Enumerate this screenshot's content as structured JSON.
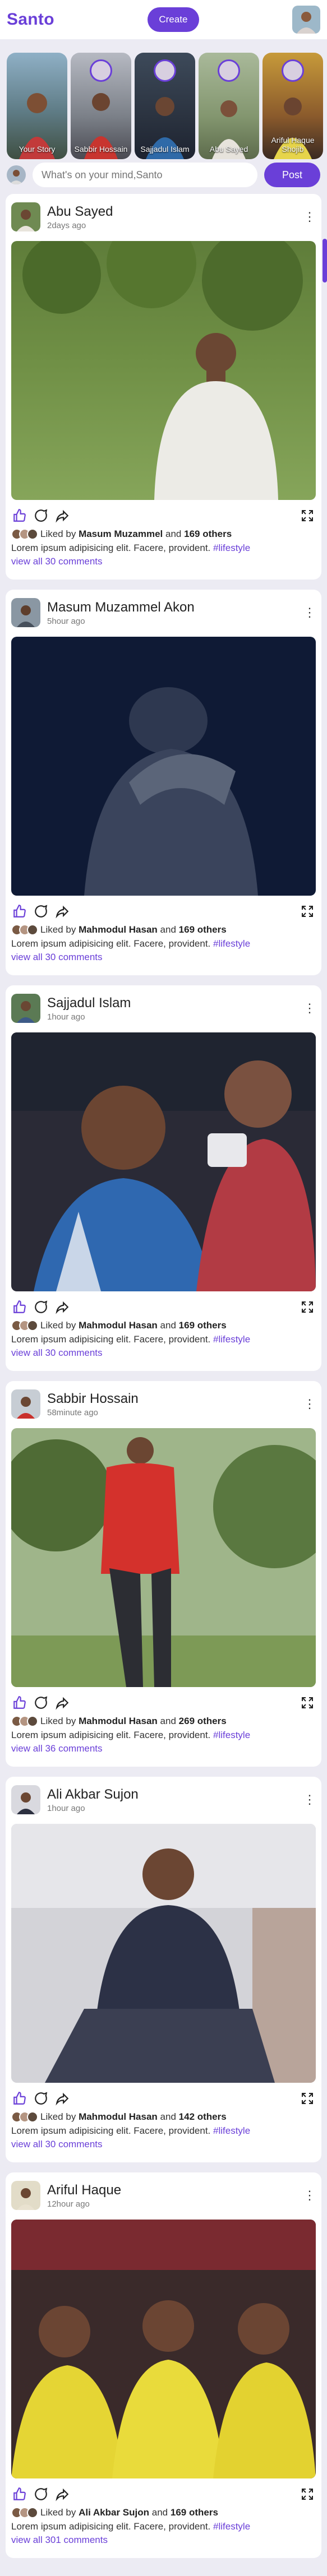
{
  "header": {
    "brand": "Santo",
    "create_label": "Create"
  },
  "stories": [
    {
      "name": "Your Story"
    },
    {
      "name": "Sabbir Hossain"
    },
    {
      "name": "Sajjadul Islam"
    },
    {
      "name": "Abu Sayed"
    },
    {
      "name": "Ariful Haque Shojib"
    }
  ],
  "composer": {
    "placeholder": "What's on your mind,Santo",
    "post_label": "Post"
  },
  "posts": [
    {
      "author": "Abu Sayed",
      "time": "2days ago",
      "liked_prefix": "Liked by",
      "liked_by": "Masum Muzammel",
      "and": "and",
      "others": "169 others",
      "caption": "Lorem ipsum adipisicing elit. Facere, provident.",
      "tag": "#lifestyle",
      "comments": "view all 30 comments"
    },
    {
      "author": "Masum Muzammel Akon",
      "time": "5hour ago",
      "liked_prefix": "Liked by",
      "liked_by": "Mahmodul Hasan",
      "and": "and",
      "others": "169 others",
      "caption": "Lorem ipsum adipisicing elit. Facere, provident.",
      "tag": "#lifestyle",
      "comments": "view all 30 comments"
    },
    {
      "author": "Sajjadul Islam",
      "time": "1hour ago",
      "liked_prefix": "Liked by",
      "liked_by": "Mahmodul Hasan",
      "and": "and",
      "others": "169 others",
      "caption": "Lorem ipsum adipisicing elit. Facere, provident.",
      "tag": "#lifestyle",
      "comments": "view all 30 comments"
    },
    {
      "author": "Sabbir Hossain",
      "time": "58minute ago",
      "liked_prefix": "Liked by",
      "liked_by": "Mahmodul Hasan",
      "and": "and",
      "others": "269 others",
      "caption": "Lorem ipsum adipisicing elit. Facere, provident.",
      "tag": "#lifestyle",
      "comments": "view all 36 comments"
    },
    {
      "author": "Ali Akbar Sujon",
      "time": "1hour ago",
      "liked_prefix": "Liked by",
      "liked_by": "Mahmodul Hasan",
      "and": "and",
      "others": "142 others",
      "caption": "Lorem ipsum adipisicing elit. Facere, provident.",
      "tag": "#lifestyle",
      "comments": "view all 30 comments"
    },
    {
      "author": "Ariful Haque",
      "time": "12hour ago",
      "liked_prefix": "Liked by",
      "liked_by": "Ali Akbar Sujon",
      "and": "and",
      "others": "169 others",
      "caption": "Lorem ipsum adipisicing elit. Facere, provident.",
      "tag": "#lifestyle",
      "comments": "view all 301 comments"
    }
  ],
  "icons": {
    "like": "thumbs-up-icon",
    "comment": "comment-icon",
    "share": "share-icon",
    "expand": "expand-icon",
    "more": "more-vertical-icon"
  },
  "colors": {
    "accent": "#6a3fd8",
    "background": "#ecebf3"
  }
}
